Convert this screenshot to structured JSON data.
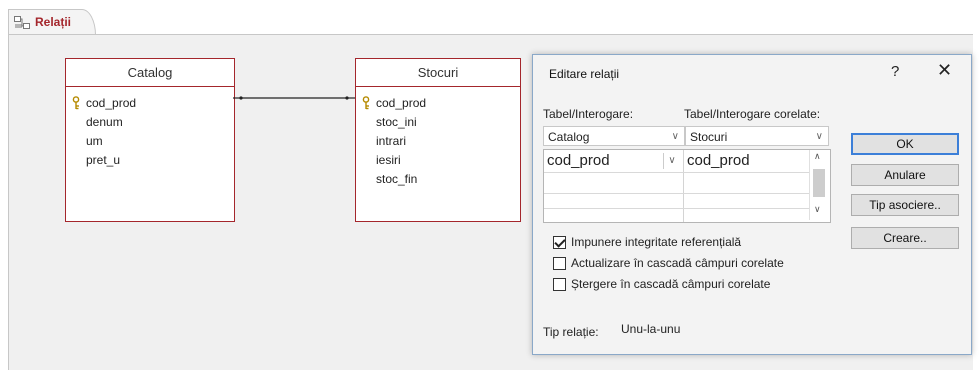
{
  "tab": {
    "label": "Relații"
  },
  "tables": {
    "catalog": {
      "title": "Catalog",
      "fields": [
        "cod_prod",
        "denum",
        "um",
        "pret_u"
      ]
    },
    "stocuri": {
      "title": "Stocuri",
      "fields": [
        "cod_prod",
        "stoc_ini",
        "intrari",
        "iesiri",
        "stoc_fin"
      ]
    }
  },
  "dialog": {
    "title": "Editare relații",
    "help": "?",
    "close": "✕",
    "table_label": "Tabel/Interogare:",
    "related_label": "Tabel/Interogare corelate:",
    "table_value": "Catalog",
    "related_value": "Stocuri",
    "grid": {
      "left_field": "cod_prod",
      "right_field": "cod_prod"
    },
    "checkboxes": [
      {
        "label": "Impunere integritate referențială",
        "checked": true
      },
      {
        "label": "Actualizare în cascadă câmpuri corelate",
        "checked": false
      },
      {
        "label": "Ștergere în cascadă câmpuri corelate",
        "checked": false
      }
    ],
    "relation_type_label": "Tip relație:",
    "relation_type_value": "Unu-la-unu",
    "buttons": {
      "ok": "OK",
      "cancel": "Anulare",
      "join": "Tip asociere..",
      "create": "Creare.."
    }
  }
}
